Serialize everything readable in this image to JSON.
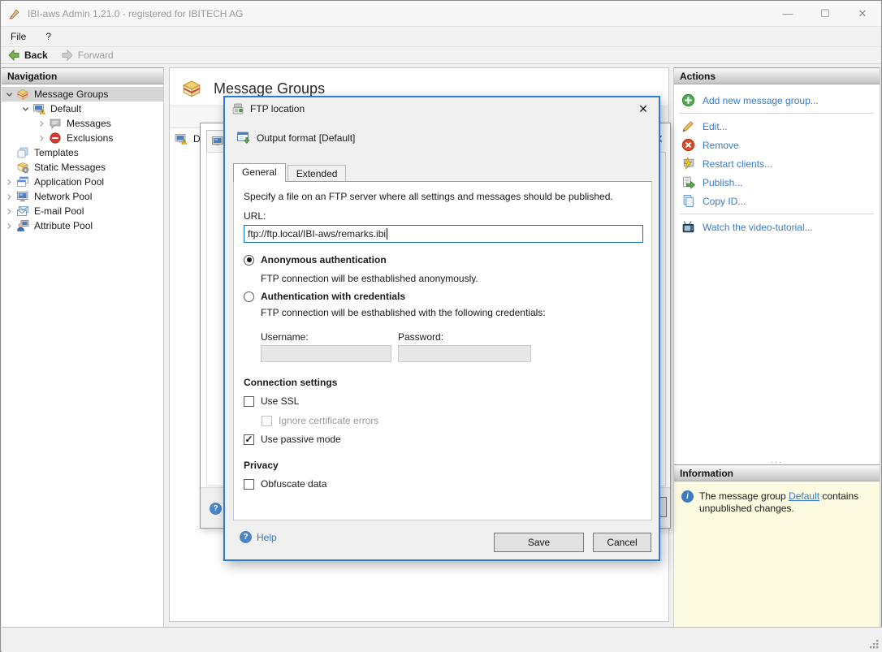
{
  "window": {
    "title": "IBI-aws Admin 1.21.0 - registered for IBITECH AG",
    "minimize_glyph": "—",
    "maximize_glyph": "☐",
    "close_glyph": "✕"
  },
  "menu": {
    "items": [
      {
        "label": "File"
      },
      {
        "label": "?"
      }
    ]
  },
  "toolbar": {
    "back_label": "Back",
    "forward_label": "Forward"
  },
  "navigation": {
    "header": "Navigation",
    "items": [
      {
        "label": "Message Groups",
        "icon": "message-groups-icon",
        "expanded": true,
        "selected": true
      },
      {
        "label": "Default",
        "icon": "default-group-icon",
        "expanded": true
      },
      {
        "label": "Messages",
        "icon": "messages-icon",
        "collapsed": true
      },
      {
        "label": "Exclusions",
        "icon": "exclusions-icon",
        "collapsed": true
      },
      {
        "label": "Templates",
        "icon": "templates-icon"
      },
      {
        "label": "Static Messages",
        "icon": "static-messages-icon"
      },
      {
        "label": "Application Pool",
        "icon": "application-pool-icon",
        "collapsed": true
      },
      {
        "label": "Network Pool",
        "icon": "network-pool-icon",
        "collapsed": true
      },
      {
        "label": "E-mail Pool",
        "icon": "email-pool-icon",
        "collapsed": true
      },
      {
        "label": "Attribute Pool",
        "icon": "attribute-pool-icon",
        "collapsed": true
      }
    ]
  },
  "content": {
    "title": "Message Groups",
    "list_row_visible_text": "D"
  },
  "actions": {
    "header": "Actions",
    "items": [
      {
        "label": "Add new message group...",
        "icon": "add-icon"
      },
      {
        "label": "Edit...",
        "icon": "edit-icon"
      },
      {
        "label": "Remove",
        "icon": "remove-icon"
      },
      {
        "label": "Restart clients...",
        "icon": "restart-clients-icon"
      },
      {
        "label": "Publish...",
        "icon": "publish-icon"
      },
      {
        "label": "Copy ID...",
        "icon": "copy-id-icon"
      },
      {
        "label": "Watch the video-tutorial...",
        "icon": "video-tutorial-icon"
      }
    ]
  },
  "information": {
    "header": "Information",
    "text_before": "The message group ",
    "link_text": "Default",
    "text_after": " contains unpublished changes."
  },
  "dialog": {
    "title": "FTP location",
    "close_glyph": "✕",
    "subtitle": "Output format [Default]",
    "tabs": [
      {
        "label": "General"
      },
      {
        "label": "Extended"
      }
    ],
    "description": "Specify a file on an FTP server where all settings and messages should be published.",
    "url_label": "URL:",
    "url_value": "ftp://ftp.local/IBI-aws/remarks.ibi",
    "auth_anonymous": {
      "label": "Anonymous authentication",
      "description": "FTP connection will be esthablished anonymously.",
      "selected": true
    },
    "auth_credentials": {
      "label": "Authentication with credentials",
      "description": "FTP connection will be esthablished with the following credentials:",
      "selected": false
    },
    "username_label": "Username:",
    "password_label": "Password:",
    "connection_settings_label": "Connection settings",
    "use_ssl_label": "Use SSL",
    "ignore_cert_label": "Ignore certificate errors",
    "passive_mode_label": "Use passive mode",
    "privacy_label": "Privacy",
    "obfuscate_label": "Obfuscate data",
    "help_label": "Help",
    "save_label": "Save",
    "cancel_label": "Cancel",
    "checkbox_states": {
      "use_ssl": false,
      "ignore_cert": false,
      "passive_mode": true,
      "obfuscate": false
    }
  },
  "colors": {
    "dialog_border_blue": "#2b7cd3",
    "link_blue": "#3b7bc4",
    "info_panel_yellow": "#fcfbe2",
    "selection_gray": "#d6d6d6"
  }
}
